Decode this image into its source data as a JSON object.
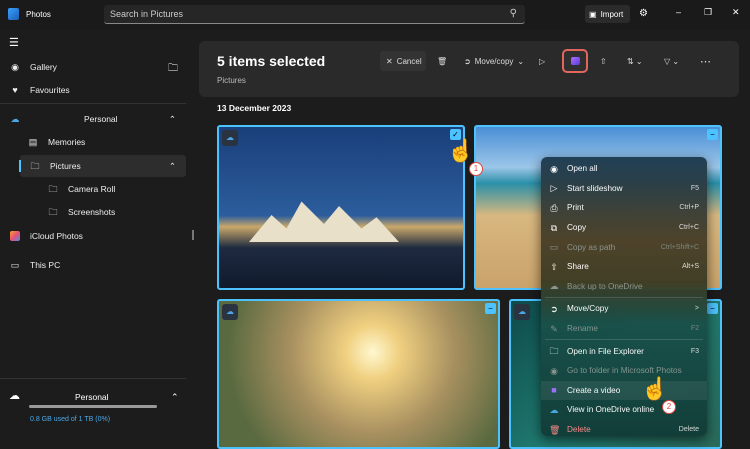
{
  "app": {
    "title": "Photos",
    "search_placeholder": "Search in Pictures",
    "import": "Import"
  },
  "sidebar": {
    "items": [
      {
        "label": "Gallery"
      },
      {
        "label": "Favourites"
      },
      {
        "label": "Personal"
      },
      {
        "label": "Memories"
      },
      {
        "label": "Pictures"
      },
      {
        "label": "Camera Roll"
      },
      {
        "label": "Screenshots"
      },
      {
        "label": "iCloud Photos"
      },
      {
        "label": "This PC"
      }
    ],
    "storage": {
      "label": "Personal",
      "text": "0.8 GB used of 1 TB (0%)",
      "fraction": 0.0
    }
  },
  "header": {
    "title": "5 items selected",
    "subtitle": "Pictures",
    "cancel": "Cancel",
    "move_copy": "Move/copy"
  },
  "date": "13 December 2023",
  "menu": [
    {
      "label": "Open all",
      "key": "",
      "icon": "eye-icon",
      "disabled": false
    },
    {
      "label": "Start slideshow",
      "key": "F5",
      "icon": "slideshow-icon",
      "disabled": false
    },
    {
      "label": "Print",
      "key": "Ctrl+P",
      "icon": "print-icon",
      "disabled": false
    },
    {
      "label": "Copy",
      "key": "Ctrl+C",
      "icon": "copy-icon",
      "disabled": false
    },
    {
      "label": "Copy as path",
      "key": "Ctrl+Shift+C",
      "icon": "path-icon",
      "disabled": true
    },
    {
      "label": "Share",
      "key": "Alt+S",
      "icon": "share-icon",
      "disabled": false
    },
    {
      "label": "Back up to OneDrive",
      "key": "",
      "icon": "backup-icon",
      "disabled": true
    },
    {
      "label": "Move/Copy",
      "key": ">",
      "icon": "move-icon",
      "disabled": false
    },
    {
      "label": "Rename",
      "key": "F2",
      "icon": "rename-icon",
      "disabled": true
    },
    {
      "label": "Open in File Explorer",
      "key": "F3",
      "icon": "folder-icon",
      "disabled": false
    },
    {
      "label": "Go to folder in Microsoft Photos",
      "key": "",
      "icon": "eye-icon",
      "disabled": true
    },
    {
      "label": "Create a video",
      "key": "",
      "icon": "video-icon",
      "disabled": false
    },
    {
      "label": "View in OneDrive online",
      "key": "",
      "icon": "cloud-icon",
      "disabled": false
    },
    {
      "label": "Delete",
      "key": "Delete",
      "icon": "trash-icon",
      "disabled": false
    }
  ],
  "steps": [
    "1",
    "2"
  ],
  "colors": {
    "accent": "#4cc2ff",
    "highlight": "#e0463e"
  }
}
